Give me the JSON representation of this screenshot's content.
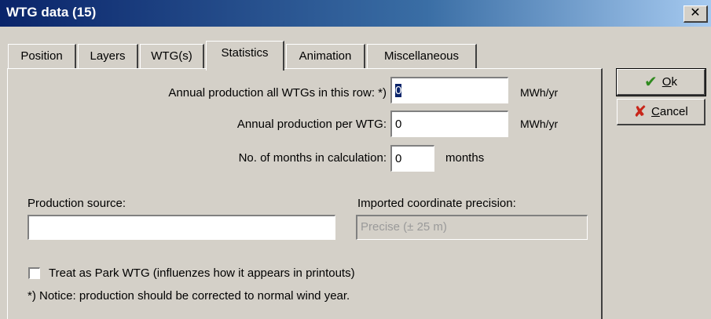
{
  "window": {
    "title": "WTG data  (15)",
    "close_glyph": "✕"
  },
  "tabs": [
    {
      "label": "Position"
    },
    {
      "label": "Layers"
    },
    {
      "label": "WTG(s)"
    },
    {
      "label": "Statistics"
    },
    {
      "label": "Animation"
    },
    {
      "label": "Miscellaneous"
    }
  ],
  "active_tab": "Statistics",
  "stats": {
    "annual_all_label": "Annual production all WTGs in this row: *)",
    "annual_all_value": "0",
    "annual_all_unit": "MWh/yr",
    "annual_per_label": "Annual production per WTG:",
    "annual_per_value": "0",
    "annual_per_unit": "MWh/yr",
    "months_label": "No. of months in calculation:",
    "months_value": "0",
    "months_unit": "months",
    "production_source_label": "Production source:",
    "production_source_value": "",
    "precision_label": "Imported coordinate precision:",
    "precision_value": "Precise (± 25 m)",
    "park_checkbox_label": "Treat as Park WTG (influenzes how it appears in printouts)",
    "park_checked": false,
    "notice": "*) Notice: production should be corrected to normal wind year."
  },
  "buttons": {
    "ok_mnemonic": "O",
    "ok_rest": "k",
    "cancel_mnemonic": "C",
    "cancel_rest": "ancel"
  },
  "icons": {
    "ok": "check-icon",
    "cancel": "x-icon",
    "ok_color": "#2f8a1f",
    "cancel_color": "#c8261a"
  }
}
